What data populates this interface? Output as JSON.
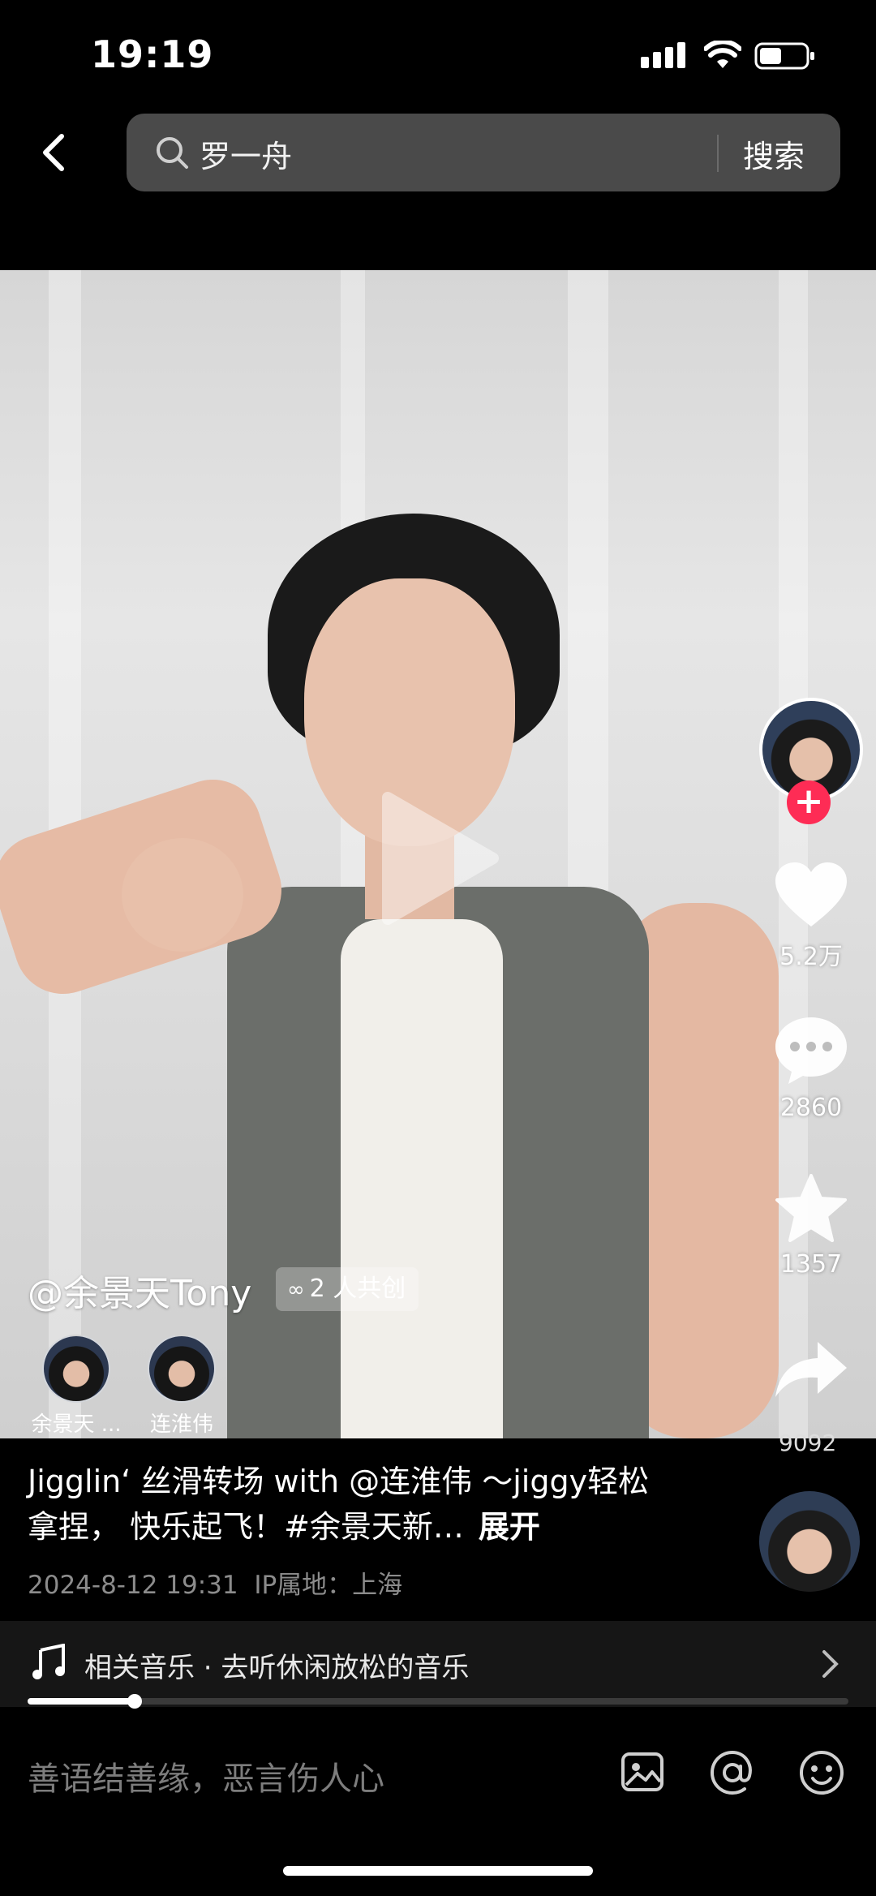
{
  "status_bar": {
    "time": "19:19"
  },
  "search": {
    "query": "罗一舟",
    "button": "搜索"
  },
  "post": {
    "author": "@余景天Tony",
    "cocreate": "2 人共创",
    "collaborators": [
      {
        "name": "余景天 ..."
      },
      {
        "name": "连淮伟"
      }
    ],
    "caption": "Jigglin‘ 丝滑转场 with @连淮伟 ～jiggy轻松拿捏， 快乐起飞！#余景天新…",
    "expand": "展开",
    "date": "2024-8-12 19:31",
    "ip": "IP属地：上海",
    "progress": 0.13
  },
  "actions": {
    "likes": "5.2万",
    "comments": "2860",
    "favorites": "1357",
    "shares": "9092"
  },
  "music": {
    "text": "相关音乐 · 去听休闲放松的音乐"
  },
  "comment_bar": {
    "placeholder": "善语结善缘，恶言伤人心"
  },
  "colors": {
    "accent": "#fe2c55",
    "background": "#000000",
    "muted": "#8c8c8c"
  }
}
